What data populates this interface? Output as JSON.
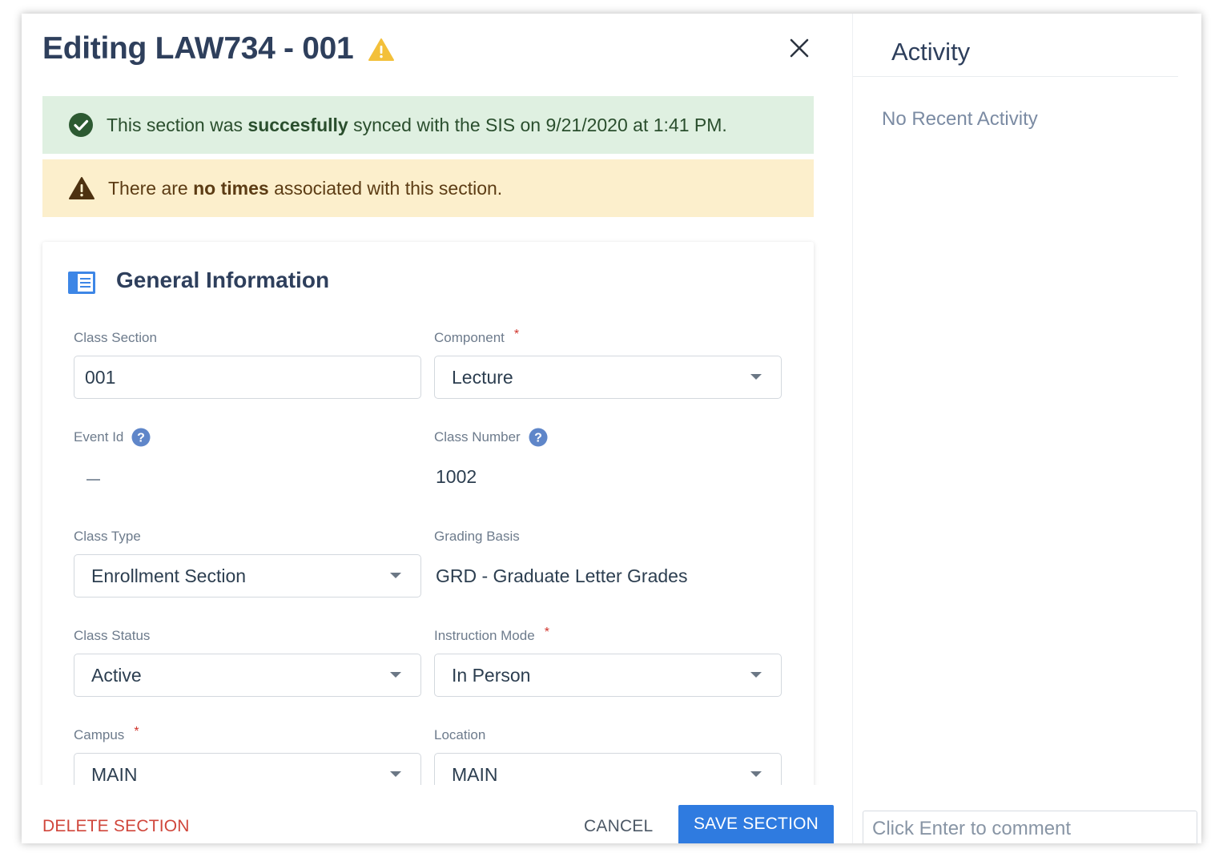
{
  "editor": {
    "title": "Editing LAW734 - 001",
    "title_icon": "warning-triangle-icon",
    "close_icon": "close-icon"
  },
  "alerts": {
    "success": {
      "icon": "check-circle-icon",
      "text_before": "This section was ",
      "text_bold": "succesfully",
      "text_after": " synced with the SIS on 9/21/2020 at 1:41 PM."
    },
    "warning": {
      "icon": "warning-triangle-icon",
      "text_before": "There are ",
      "text_bold": "no times",
      "text_after": " associated with this section."
    }
  },
  "general_information": {
    "title": "General Information",
    "icon": "info-card-icon",
    "fields": {
      "class_section": {
        "label": "Class Section",
        "value": "001"
      },
      "component": {
        "label": "Component",
        "required_mark": "*",
        "value": "Lecture"
      },
      "event_id": {
        "label": "Event Id",
        "value": "—"
      },
      "class_number": {
        "label": "Class Number",
        "value": "1002"
      },
      "class_type": {
        "label": "Class Type",
        "value": "Enrollment Section"
      },
      "grading_basis": {
        "label": "Grading Basis",
        "value": "GRD - Graduate Letter Grades"
      },
      "class_status": {
        "label": "Class Status",
        "value": "Active"
      },
      "instruction_mode": {
        "label": "Instruction Mode",
        "required_mark": "*",
        "value": "In Person"
      },
      "campus": {
        "label": "Campus",
        "required_mark": "*",
        "value": "MAIN"
      },
      "location": {
        "label": "Location",
        "value": "MAIN"
      }
    }
  },
  "footer": {
    "delete_label": "DELETE SECTION",
    "cancel_label": "CANCEL",
    "save_label": "SAVE SECTION"
  },
  "activity": {
    "title": "Activity",
    "empty_text": "No Recent Activity",
    "comment_placeholder": "Click Enter to comment"
  },
  "colors": {
    "primary": "#2f7be0",
    "danger": "#d0463b",
    "success_bg": "#dff0e1",
    "warning_bg": "#fcefcc",
    "heading": "#2e3f5c"
  }
}
